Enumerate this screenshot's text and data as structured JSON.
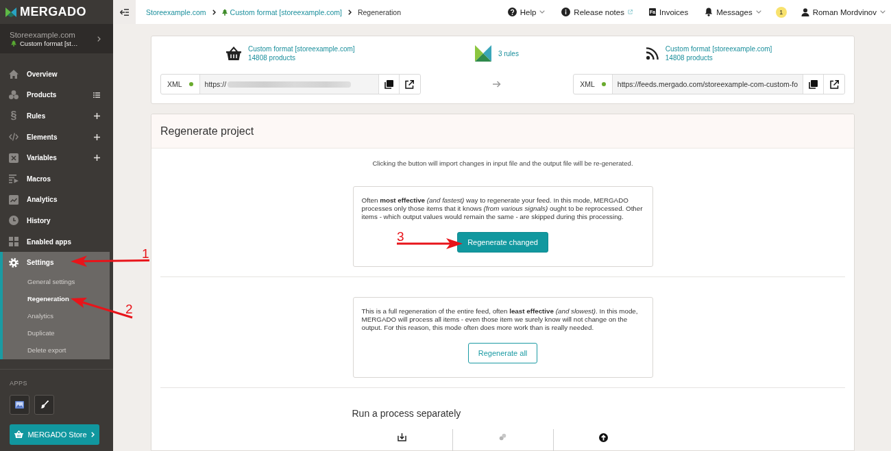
{
  "sidebar": {
    "logo": "MERGADO",
    "project": {
      "name": "Storeexample.com",
      "export": "Custom format [st…"
    },
    "nav": [
      {
        "label": "Overview",
        "kind": "link",
        "selected": false
      },
      {
        "label": "Products",
        "kind": "list",
        "selected": false
      },
      {
        "label": "Rules",
        "kind": "add",
        "symbol": "§",
        "selected": false
      },
      {
        "label": "Elements",
        "kind": "add",
        "selected": false
      },
      {
        "label": "Variables",
        "kind": "add",
        "selected": false
      },
      {
        "label": "Macros",
        "kind": "link",
        "selected": false
      },
      {
        "label": "Analytics",
        "kind": "link",
        "selected": false
      },
      {
        "label": "History",
        "kind": "link",
        "selected": false
      },
      {
        "label": "Enabled apps",
        "kind": "link",
        "selected": false
      },
      {
        "label": "Settings",
        "kind": "link",
        "selected": true,
        "expanded": true,
        "children": [
          {
            "label": "General settings",
            "selected": false
          },
          {
            "label": "Regeneration",
            "selected": true
          },
          {
            "label": "Analytics",
            "selected": false
          },
          {
            "label": "Duplicate",
            "selected": false
          },
          {
            "label": "Delete export",
            "selected": false
          }
        ]
      }
    ],
    "apps_heading": "APPS",
    "store_button": "MERGADO Store"
  },
  "topbar": {
    "breadcrumbs": [
      {
        "label": "Storeexample.com",
        "kind": "site"
      },
      {
        "label": "Custom format [storeexample.com]",
        "kind": "export"
      },
      {
        "label": "Regeneration",
        "kind": "current"
      }
    ],
    "menu": [
      {
        "kind": "link",
        "label": "Help",
        "dropdown": true,
        "external": false
      },
      {
        "kind": "link",
        "label": "Release notes",
        "dropdown": false,
        "external": true
      },
      {
        "kind": "link",
        "label": "Invoices",
        "icon_text": "Fa",
        "dropdown": false,
        "external": false
      },
      {
        "kind": "link",
        "label": "Messages",
        "dropdown": true,
        "external": false
      },
      {
        "kind": "badge",
        "label": "1"
      },
      {
        "kind": "link",
        "label": "Roman Mordvinov",
        "dropdown": true,
        "external": false
      }
    ]
  },
  "feed": {
    "source": {
      "name": "Custom format [storeexample.com]",
      "count": "14808 products",
      "format": "XML",
      "active": true,
      "url": "https://",
      "blurred": true
    },
    "rules": "3 rules",
    "output": {
      "name": "Custom format [storeexample.com]",
      "count": "14808 products",
      "format": "XML",
      "active": true,
      "url": "https://feeds.mergado.com/storeexample-com-custom-fo",
      "blurred": false
    }
  },
  "regenerate": {
    "title": "Regenerate project",
    "intro": "Clicking the button will import changes in input file and the output file will be re-generated.",
    "options": [
      {
        "text": "Often **most effective** *(and fastest)* way to regenerate your feed. In this mode, MERGADO processes only those items that it knows *(from various signals)* ought to be reprocessed. Other items - which output values would remain the same - are skipped during this processing.",
        "button": "Regenerate changed",
        "kind": "primary"
      },
      {
        "text": "This is a full regeneration of the entire feed, often **least effective** *(and slowest)*. In this mode, MERGADO will process all items - even those item we surely know will not change on the output. For this reason, this mode often does more work than is really needed.",
        "button": "Regenerate all",
        "kind": "outline"
      }
    ],
    "processes_title": "Run a process separately"
  },
  "annotations": [
    {
      "label": "1"
    },
    {
      "label": "2"
    },
    {
      "label": "3"
    }
  ]
}
